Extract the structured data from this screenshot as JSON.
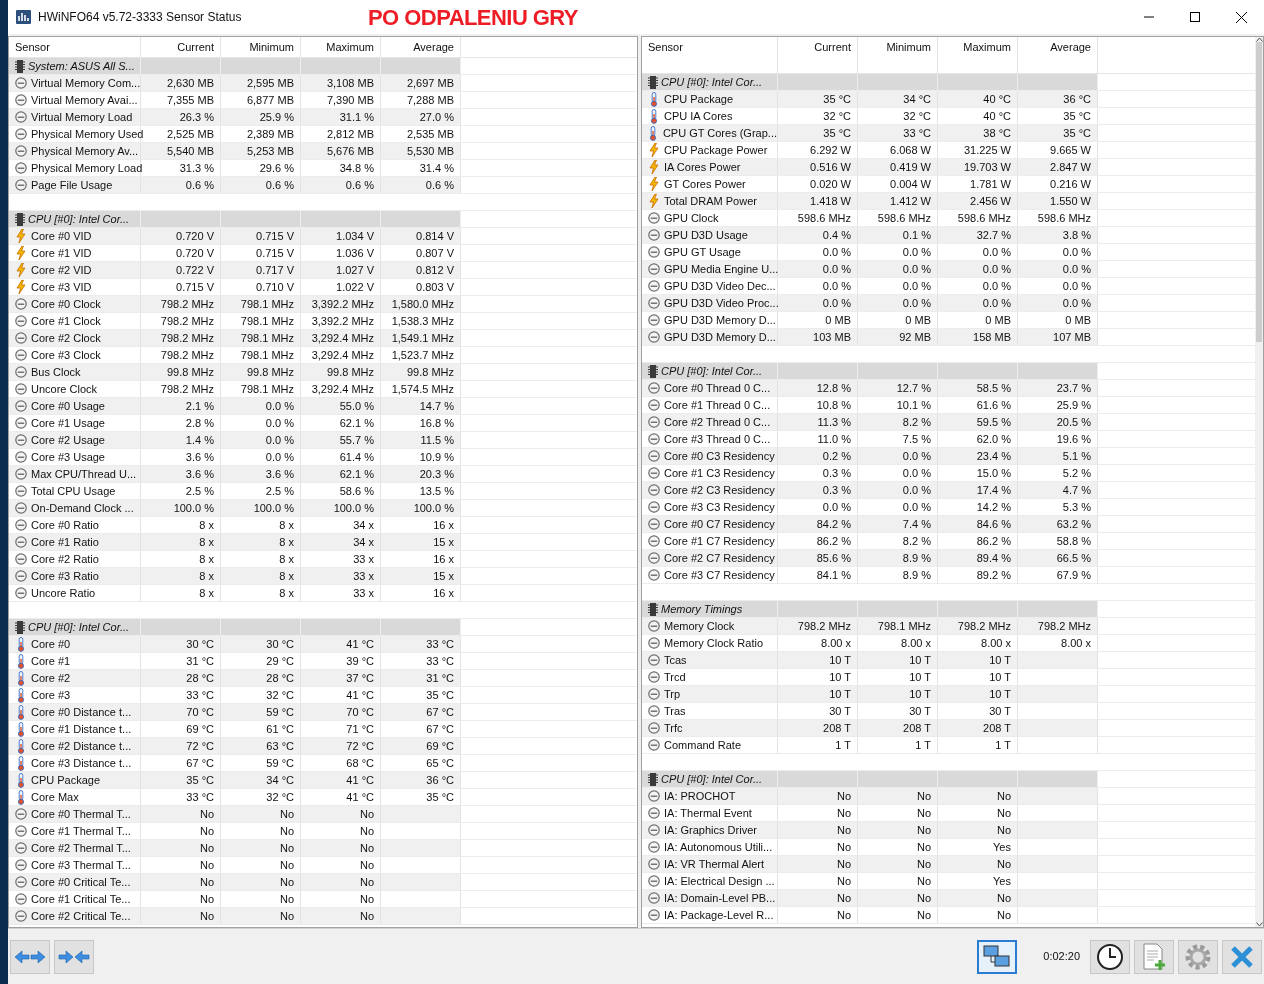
{
  "window": {
    "title": "HWiNFO64 v5.72-3333 Sensor Status",
    "annotation": "PO ODPALENIU GRY"
  },
  "panels": [
    {
      "columns": [
        "Sensor",
        "Current",
        "Minimum",
        "Maximum",
        "Average"
      ],
      "groups": [
        {
          "name": "System: ASUS All S...",
          "rows": [
            {
              "kind": "gauge",
              "sensor": "Virtual Memory Com...",
              "current": "2,630 MB",
              "minimum": "2,595 MB",
              "maximum": "3,108 MB",
              "average": "2,697 MB"
            },
            {
              "kind": "gauge",
              "sensor": "Virtual Memory Avai...",
              "current": "7,355 MB",
              "minimum": "6,877 MB",
              "maximum": "7,390 MB",
              "average": "7,288 MB"
            },
            {
              "kind": "gauge",
              "sensor": "Virtual Memory Load",
              "current": "26.3 %",
              "minimum": "25.9 %",
              "maximum": "31.1 %",
              "average": "27.0 %"
            },
            {
              "kind": "gauge",
              "sensor": "Physical Memory Used",
              "current": "2,525 MB",
              "minimum": "2,389 MB",
              "maximum": "2,812 MB",
              "average": "2,535 MB"
            },
            {
              "kind": "gauge",
              "sensor": "Physical Memory Av...",
              "current": "5,540 MB",
              "minimum": "5,253 MB",
              "maximum": "5,676 MB",
              "average": "5,530 MB"
            },
            {
              "kind": "gauge",
              "sensor": "Physical Memory Load",
              "current": "31.3 %",
              "minimum": "29.6 %",
              "maximum": "34.8 %",
              "average": "31.4 %"
            },
            {
              "kind": "gauge",
              "sensor": "Page File Usage",
              "current": "0.6 %",
              "minimum": "0.6 %",
              "maximum": "0.6 %",
              "average": "0.6 %"
            }
          ]
        },
        {
          "name": "CPU [#0]: Intel Cor...",
          "rows": [
            {
              "kind": "bolt",
              "sensor": "Core #0 VID",
              "current": "0.720 V",
              "minimum": "0.715 V",
              "maximum": "1.034 V",
              "average": "0.814 V"
            },
            {
              "kind": "bolt",
              "sensor": "Core #1 VID",
              "current": "0.720 V",
              "minimum": "0.715 V",
              "maximum": "1.036 V",
              "average": "0.807 V"
            },
            {
              "kind": "bolt",
              "sensor": "Core #2 VID",
              "current": "0.722 V",
              "minimum": "0.717 V",
              "maximum": "1.027 V",
              "average": "0.812 V"
            },
            {
              "kind": "bolt",
              "sensor": "Core #3 VID",
              "current": "0.715 V",
              "minimum": "0.710 V",
              "maximum": "1.022 V",
              "average": "0.803 V"
            },
            {
              "kind": "gauge",
              "sensor": "Core #0 Clock",
              "current": "798.2 MHz",
              "minimum": "798.1 MHz",
              "maximum": "3,392.2 MHz",
              "average": "1,580.0 MHz"
            },
            {
              "kind": "gauge",
              "sensor": "Core #1 Clock",
              "current": "798.2 MHz",
              "minimum": "798.1 MHz",
              "maximum": "3,392.2 MHz",
              "average": "1,538.3 MHz"
            },
            {
              "kind": "gauge",
              "sensor": "Core #2 Clock",
              "current": "798.2 MHz",
              "minimum": "798.1 MHz",
              "maximum": "3,292.4 MHz",
              "average": "1,549.1 MHz"
            },
            {
              "kind": "gauge",
              "sensor": "Core #3 Clock",
              "current": "798.2 MHz",
              "minimum": "798.1 MHz",
              "maximum": "3,292.4 MHz",
              "average": "1,523.7 MHz"
            },
            {
              "kind": "gauge",
              "sensor": "Bus Clock",
              "current": "99.8 MHz",
              "minimum": "99.8 MHz",
              "maximum": "99.8 MHz",
              "average": "99.8 MHz"
            },
            {
              "kind": "gauge",
              "sensor": "Uncore Clock",
              "current": "798.2 MHz",
              "minimum": "798.1 MHz",
              "maximum": "3,292.4 MHz",
              "average": "1,574.5 MHz"
            },
            {
              "kind": "gauge",
              "sensor": "Core #0 Usage",
              "current": "2.1 %",
              "minimum": "0.0 %",
              "maximum": "55.0 %",
              "average": "14.7 %"
            },
            {
              "kind": "gauge",
              "sensor": "Core #1 Usage",
              "current": "2.8 %",
              "minimum": "0.0 %",
              "maximum": "62.1 %",
              "average": "16.8 %"
            },
            {
              "kind": "gauge",
              "sensor": "Core #2 Usage",
              "current": "1.4 %",
              "minimum": "0.0 %",
              "maximum": "55.7 %",
              "average": "11.5 %"
            },
            {
              "kind": "gauge",
              "sensor": "Core #3 Usage",
              "current": "3.6 %",
              "minimum": "0.0 %",
              "maximum": "61.4 %",
              "average": "10.9 %"
            },
            {
              "kind": "gauge",
              "sensor": "Max CPU/Thread U...",
              "current": "3.6 %",
              "minimum": "3.6 %",
              "maximum": "62.1 %",
              "average": "20.3 %"
            },
            {
              "kind": "gauge",
              "sensor": "Total CPU Usage",
              "current": "2.5 %",
              "minimum": "2.5 %",
              "maximum": "58.6 %",
              "average": "13.5 %"
            },
            {
              "kind": "gauge",
              "sensor": "On-Demand Clock ...",
              "current": "100.0 %",
              "minimum": "100.0 %",
              "maximum": "100.0 %",
              "average": "100.0 %"
            },
            {
              "kind": "gauge",
              "sensor": "Core #0 Ratio",
              "current": "8 x",
              "minimum": "8 x",
              "maximum": "34 x",
              "average": "16 x"
            },
            {
              "kind": "gauge",
              "sensor": "Core #1 Ratio",
              "current": "8 x",
              "minimum": "8 x",
              "maximum": "34 x",
              "average": "15 x"
            },
            {
              "kind": "gauge",
              "sensor": "Core #2 Ratio",
              "current": "8 x",
              "minimum": "8 x",
              "maximum": "33 x",
              "average": "16 x"
            },
            {
              "kind": "gauge",
              "sensor": "Core #3 Ratio",
              "current": "8 x",
              "minimum": "8 x",
              "maximum": "33 x",
              "average": "15 x"
            },
            {
              "kind": "gauge",
              "sensor": "Uncore Ratio",
              "current": "8 x",
              "minimum": "8 x",
              "maximum": "33 x",
              "average": "16 x"
            }
          ]
        },
        {
          "name": "CPU [#0]: Intel Cor...",
          "rows": [
            {
              "kind": "thermo",
              "sensor": "Core #0",
              "current": "30 °C",
              "minimum": "30 °C",
              "maximum": "41 °C",
              "average": "33 °C"
            },
            {
              "kind": "thermo",
              "sensor": "Core #1",
              "current": "31 °C",
              "minimum": "29 °C",
              "maximum": "39 °C",
              "average": "33 °C"
            },
            {
              "kind": "thermo",
              "sensor": "Core #2",
              "current": "28 °C",
              "minimum": "28 °C",
              "maximum": "37 °C",
              "average": "31 °C"
            },
            {
              "kind": "thermo",
              "sensor": "Core #3",
              "current": "33 °C",
              "minimum": "32 °C",
              "maximum": "41 °C",
              "average": "35 °C"
            },
            {
              "kind": "thermo",
              "sensor": "Core #0 Distance t...",
              "current": "70 °C",
              "minimum": "59 °C",
              "maximum": "70 °C",
              "average": "67 °C"
            },
            {
              "kind": "thermo",
              "sensor": "Core #1 Distance t...",
              "current": "69 °C",
              "minimum": "61 °C",
              "maximum": "71 °C",
              "average": "67 °C"
            },
            {
              "kind": "thermo",
              "sensor": "Core #2 Distance t...",
              "current": "72 °C",
              "minimum": "63 °C",
              "maximum": "72 °C",
              "average": "69 °C"
            },
            {
              "kind": "thermo",
              "sensor": "Core #3 Distance t...",
              "current": "67 °C",
              "minimum": "59 °C",
              "maximum": "68 °C",
              "average": "65 °C"
            },
            {
              "kind": "thermo",
              "sensor": "CPU Package",
              "current": "35 °C",
              "minimum": "34 °C",
              "maximum": "41 °C",
              "average": "36 °C"
            },
            {
              "kind": "thermo",
              "sensor": "Core Max",
              "current": "33 °C",
              "minimum": "32 °C",
              "maximum": "41 °C",
              "average": "35 °C"
            },
            {
              "kind": "gauge",
              "sensor": "Core #0 Thermal T...",
              "current": "No",
              "minimum": "No",
              "maximum": "No"
            },
            {
              "kind": "gauge",
              "sensor": "Core #1 Thermal T...",
              "current": "No",
              "minimum": "No",
              "maximum": "No"
            },
            {
              "kind": "gauge",
              "sensor": "Core #2 Thermal T...",
              "current": "No",
              "minimum": "No",
              "maximum": "No"
            },
            {
              "kind": "gauge",
              "sensor": "Core #3 Thermal T...",
              "current": "No",
              "minimum": "No",
              "maximum": "No"
            },
            {
              "kind": "gauge",
              "sensor": "Core #0 Critical Te...",
              "current": "No",
              "minimum": "No",
              "maximum": "No"
            },
            {
              "kind": "gauge",
              "sensor": "Core #1 Critical Te...",
              "current": "No",
              "minimum": "No",
              "maximum": "No"
            },
            {
              "kind": "gauge",
              "sensor": "Core #2 Critical Te...",
              "current": "No",
              "minimum": "No",
              "maximum": "No"
            }
          ]
        }
      ]
    },
    {
      "columns": [
        "Sensor",
        "Current",
        "Minimum",
        "Maximum",
        "Average"
      ],
      "groups": [
        {
          "name": "CPU [#0]: Intel Cor...",
          "rows": [
            {
              "kind": "thermo",
              "sensor": "CPU Package",
              "current": "35 °C",
              "minimum": "34 °C",
              "maximum": "40 °C",
              "average": "36 °C"
            },
            {
              "kind": "thermo",
              "sensor": "CPU IA Cores",
              "current": "32 °C",
              "minimum": "32 °C",
              "maximum": "40 °C",
              "average": "35 °C"
            },
            {
              "kind": "thermo",
              "sensor": "CPU GT Cores (Grap...",
              "current": "35 °C",
              "minimum": "33 °C",
              "maximum": "38 °C",
              "average": "35 °C"
            },
            {
              "kind": "bolt",
              "sensor": "CPU Package Power",
              "current": "6.292 W",
              "minimum": "6.068 W",
              "maximum": "31.225 W",
              "average": "9.665 W"
            },
            {
              "kind": "bolt",
              "sensor": "IA Cores Power",
              "current": "0.516 W",
              "minimum": "0.419 W",
              "maximum": "19.703 W",
              "average": "2.847 W"
            },
            {
              "kind": "bolt",
              "sensor": "GT Cores Power",
              "current": "0.020 W",
              "minimum": "0.004 W",
              "maximum": "1.781 W",
              "average": "0.216 W"
            },
            {
              "kind": "bolt",
              "sensor": "Total DRAM Power",
              "current": "1.418 W",
              "minimum": "1.412 W",
              "maximum": "2.456 W",
              "average": "1.550 W"
            },
            {
              "kind": "gauge",
              "sensor": "GPU Clock",
              "current": "598.6 MHz",
              "minimum": "598.6 MHz",
              "maximum": "598.6 MHz",
              "average": "598.6 MHz"
            },
            {
              "kind": "gauge",
              "sensor": "GPU D3D Usage",
              "current": "0.4 %",
              "minimum": "0.1 %",
              "maximum": "32.7 %",
              "average": "3.8 %"
            },
            {
              "kind": "gauge",
              "sensor": "GPU GT Usage",
              "current": "0.0 %",
              "minimum": "0.0 %",
              "maximum": "0.0 %",
              "average": "0.0 %"
            },
            {
              "kind": "gauge",
              "sensor": "GPU Media Engine U...",
              "current": "0.0 %",
              "minimum": "0.0 %",
              "maximum": "0.0 %",
              "average": "0.0 %"
            },
            {
              "kind": "gauge",
              "sensor": "GPU D3D Video Dec...",
              "current": "0.0 %",
              "minimum": "0.0 %",
              "maximum": "0.0 %",
              "average": "0.0 %"
            },
            {
              "kind": "gauge",
              "sensor": "GPU D3D Video Proc...",
              "current": "0.0 %",
              "minimum": "0.0 %",
              "maximum": "0.0 %",
              "average": "0.0 %"
            },
            {
              "kind": "gauge",
              "sensor": "GPU D3D Memory D...",
              "current": "0 MB",
              "minimum": "0 MB",
              "maximum": "0 MB",
              "average": "0 MB"
            },
            {
              "kind": "gauge",
              "sensor": "GPU D3D Memory D...",
              "current": "103 MB",
              "minimum": "92 MB",
              "maximum": "158 MB",
              "average": "107 MB"
            }
          ]
        },
        {
          "name": "CPU [#0]: Intel Cor...",
          "rows": [
            {
              "kind": "gauge",
              "sensor": "Core #0 Thread 0 C...",
              "current": "12.8 %",
              "minimum": "12.7 %",
              "maximum": "58.5 %",
              "average": "23.7 %"
            },
            {
              "kind": "gauge",
              "sensor": "Core #1 Thread 0 C...",
              "current": "10.8 %",
              "minimum": "10.1 %",
              "maximum": "61.6 %",
              "average": "25.9 %"
            },
            {
              "kind": "gauge",
              "sensor": "Core #2 Thread 0 C...",
              "current": "11.3 %",
              "minimum": "8.2 %",
              "maximum": "59.5 %",
              "average": "20.5 %"
            },
            {
              "kind": "gauge",
              "sensor": "Core #3 Thread 0 C...",
              "current": "11.0 %",
              "minimum": "7.5 %",
              "maximum": "62.0 %",
              "average": "19.6 %"
            },
            {
              "kind": "gauge",
              "sensor": "Core #0 C3 Residency",
              "current": "0.2 %",
              "minimum": "0.0 %",
              "maximum": "23.4 %",
              "average": "5.1 %"
            },
            {
              "kind": "gauge",
              "sensor": "Core #1 C3 Residency",
              "current": "0.3 %",
              "minimum": "0.0 %",
              "maximum": "15.0 %",
              "average": "5.2 %"
            },
            {
              "kind": "gauge",
              "sensor": "Core #2 C3 Residency",
              "current": "0.3 %",
              "minimum": "0.0 %",
              "maximum": "17.4 %",
              "average": "4.7 %"
            },
            {
              "kind": "gauge",
              "sensor": "Core #3 C3 Residency",
              "current": "0.0 %",
              "minimum": "0.0 %",
              "maximum": "14.2 %",
              "average": "5.3 %"
            },
            {
              "kind": "gauge",
              "sensor": "Core #0 C7 Residency",
              "current": "84.2 %",
              "minimum": "7.4 %",
              "maximum": "84.6 %",
              "average": "63.2 %"
            },
            {
              "kind": "gauge",
              "sensor": "Core #1 C7 Residency",
              "current": "86.2 %",
              "minimum": "8.2 %",
              "maximum": "86.2 %",
              "average": "58.8 %"
            },
            {
              "kind": "gauge",
              "sensor": "Core #2 C7 Residency",
              "current": "85.6 %",
              "minimum": "8.9 %",
              "maximum": "89.4 %",
              "average": "66.5 %"
            },
            {
              "kind": "gauge",
              "sensor": "Core #3 C7 Residency",
              "current": "84.1 %",
              "minimum": "8.9 %",
              "maximum": "89.2 %",
              "average": "67.9 %"
            }
          ]
        },
        {
          "name": "Memory Timings",
          "rows": [
            {
              "kind": "gauge",
              "sensor": "Memory Clock",
              "current": "798.2 MHz",
              "minimum": "798.1 MHz",
              "maximum": "798.2 MHz",
              "average": "798.2 MHz"
            },
            {
              "kind": "gauge",
              "sensor": "Memory Clock Ratio",
              "current": "8.00 x",
              "minimum": "8.00 x",
              "maximum": "8.00 x",
              "average": "8.00 x"
            },
            {
              "kind": "gauge",
              "sensor": "Tcas",
              "current": "10 T",
              "minimum": "10 T",
              "maximum": "10 T"
            },
            {
              "kind": "gauge",
              "sensor": "Trcd",
              "current": "10 T",
              "minimum": "10 T",
              "maximum": "10 T"
            },
            {
              "kind": "gauge",
              "sensor": "Trp",
              "current": "10 T",
              "minimum": "10 T",
              "maximum": "10 T"
            },
            {
              "kind": "gauge",
              "sensor": "Tras",
              "current": "30 T",
              "minimum": "30 T",
              "maximum": "30 T"
            },
            {
              "kind": "gauge",
              "sensor": "Trfc",
              "current": "208 T",
              "minimum": "208 T",
              "maximum": "208 T"
            },
            {
              "kind": "gauge",
              "sensor": "Command Rate",
              "current": "1 T",
              "minimum": "1 T",
              "maximum": "1 T"
            }
          ]
        },
        {
          "name": "CPU [#0]: Intel Cor...",
          "rows": [
            {
              "kind": "gauge",
              "sensor": "IA: PROCHOT",
              "current": "No",
              "minimum": "No",
              "maximum": "No"
            },
            {
              "kind": "gauge",
              "sensor": "IA: Thermal Event",
              "current": "No",
              "minimum": "No",
              "maximum": "No"
            },
            {
              "kind": "gauge",
              "sensor": "IA: Graphics Driver",
              "current": "No",
              "minimum": "No",
              "maximum": "No"
            },
            {
              "kind": "gauge",
              "sensor": "IA: Autonomous Utili...",
              "current": "No",
              "minimum": "No",
              "maximum": "Yes"
            },
            {
              "kind": "gauge",
              "sensor": "IA: VR Thermal Alert",
              "current": "No",
              "minimum": "No",
              "maximum": "No"
            },
            {
              "kind": "gauge",
              "sensor": "IA: Electrical Design ...",
              "current": "No",
              "minimum": "No",
              "maximum": "Yes"
            },
            {
              "kind": "gauge",
              "sensor": "IA: Domain-Level PB...",
              "current": "No",
              "minimum": "No",
              "maximum": "No"
            },
            {
              "kind": "gauge",
              "sensor": "IA: Package-Level R...",
              "current": "No",
              "minimum": "No",
              "maximum": "No"
            }
          ]
        }
      ]
    }
  ],
  "toolbar": {
    "timer": "0:02:20"
  }
}
